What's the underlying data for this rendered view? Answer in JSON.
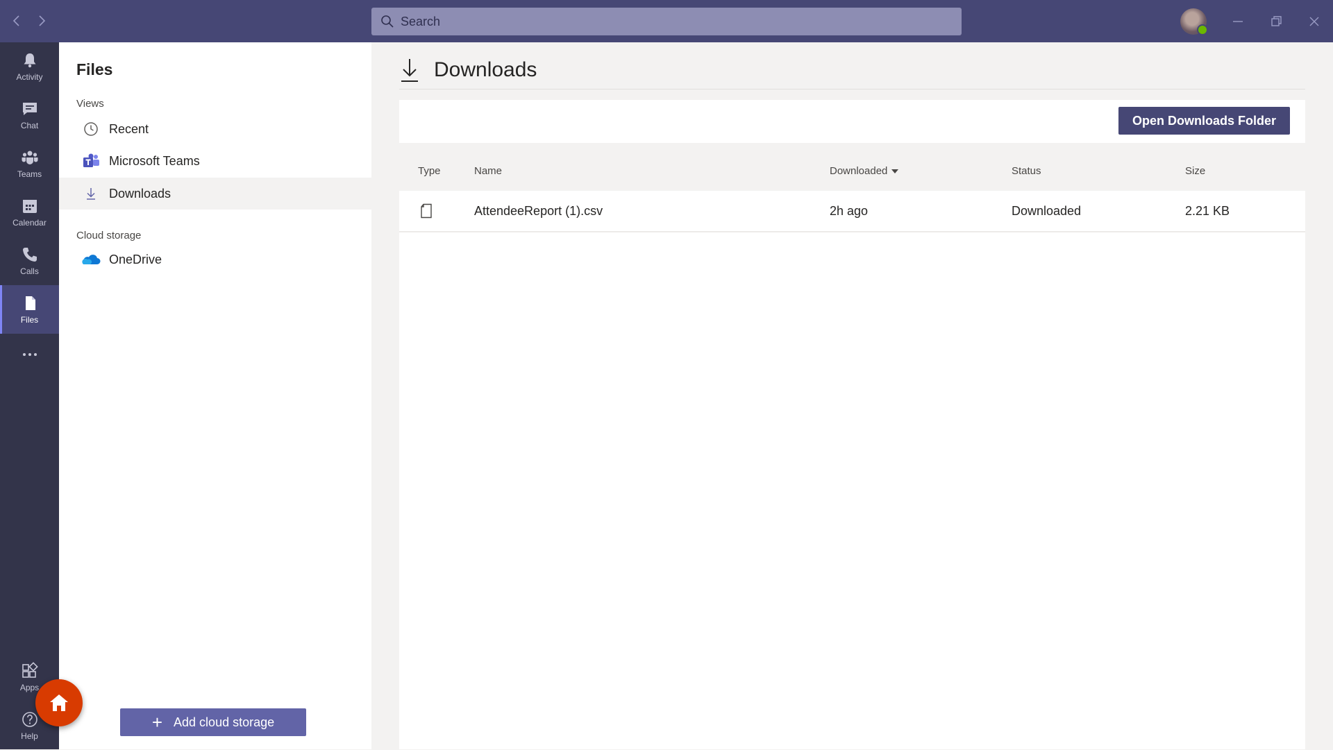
{
  "titlebar": {
    "search_placeholder": "Search"
  },
  "rail": {
    "items": [
      {
        "label": "Activity",
        "icon": "bell-icon"
      },
      {
        "label": "Chat",
        "icon": "chat-icon"
      },
      {
        "label": "Teams",
        "icon": "teams-icon"
      },
      {
        "label": "Calendar",
        "icon": "calendar-icon"
      },
      {
        "label": "Calls",
        "icon": "phone-icon"
      },
      {
        "label": "Files",
        "icon": "file-icon",
        "active": true
      },
      {
        "label": "",
        "icon": "more-icon"
      }
    ],
    "bottom": [
      {
        "label": "Apps",
        "icon": "apps-icon"
      },
      {
        "label": "Help",
        "icon": "help-icon"
      }
    ]
  },
  "panel": {
    "title": "Files",
    "views_label": "Views",
    "views": [
      {
        "label": "Recent",
        "icon": "clock-icon"
      },
      {
        "label": "Microsoft Teams",
        "icon": "teams-logo-icon"
      },
      {
        "label": "Downloads",
        "icon": "download-icon",
        "active": true
      }
    ],
    "cloud_label": "Cloud storage",
    "cloud": [
      {
        "label": "OneDrive",
        "icon": "onedrive-icon"
      }
    ],
    "add_button": "Add cloud storage"
  },
  "main": {
    "title": "Downloads",
    "open_button": "Open Downloads Folder",
    "columns": {
      "type": "Type",
      "name": "Name",
      "downloaded": "Downloaded",
      "status": "Status",
      "size": "Size"
    },
    "rows": [
      {
        "type_icon": "document-icon",
        "name": "AttendeeReport (1).csv",
        "downloaded": "2h ago",
        "status": "Downloaded",
        "size": "2.21 KB"
      }
    ]
  },
  "colors": {
    "titlebar": "#464775",
    "rail": "#33344a",
    "accent": "#6264a7",
    "home_fab": "#d83b01"
  }
}
